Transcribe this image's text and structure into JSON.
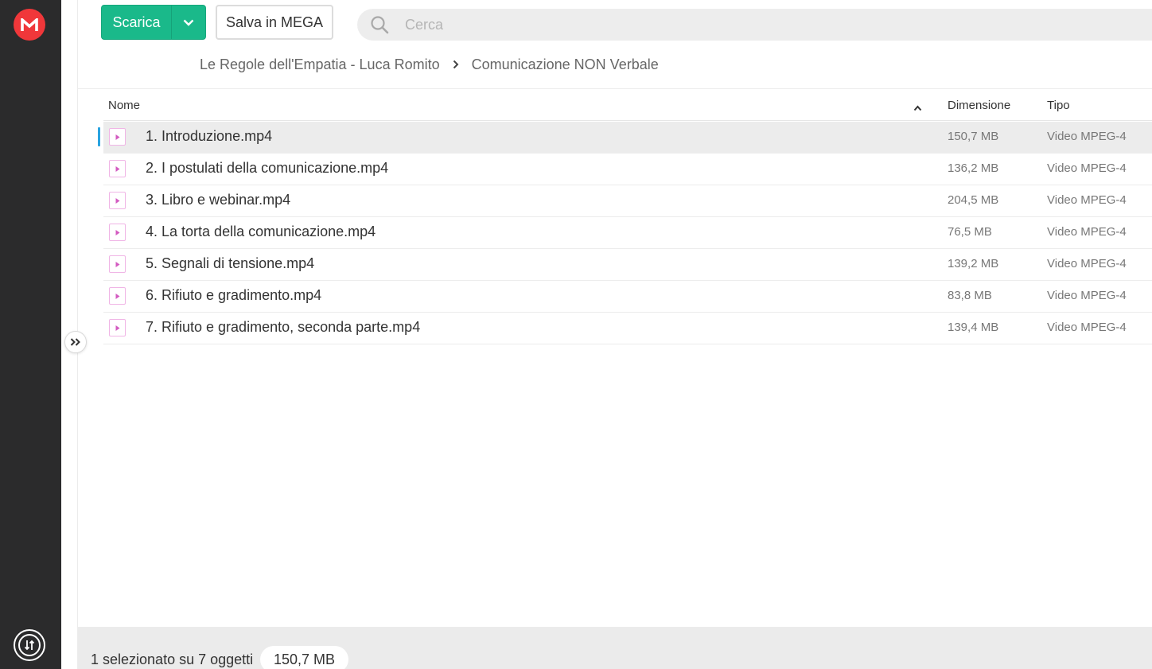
{
  "colors": {
    "rail": "#2b2b2c",
    "brand": "#f0373a",
    "download": "#1ab98a",
    "selection_marker": "#29a3e0",
    "file_icon": "#d35bc1"
  },
  "toolbar": {
    "download_label": "Scarica",
    "save_label": "Salva in MEGA"
  },
  "search": {
    "placeholder": "Cerca"
  },
  "breadcrumb": [
    {
      "label": "Le Regole dell'Empatia - Luca Romito"
    },
    {
      "label": "Comunicazione NON Verbale"
    }
  ],
  "table": {
    "columns": {
      "name": "Nome",
      "size": "Dimensione",
      "type": "Tipo"
    },
    "rows": [
      {
        "name": "1. Introduzione.mp4",
        "size": "150,7 MB",
        "type": "Video MPEG-4",
        "selected": true
      },
      {
        "name": "2. I postulati della comunicazione.mp4",
        "size": "136,2 MB",
        "type": "Video MPEG-4",
        "selected": false
      },
      {
        "name": "3. Libro e webinar.mp4",
        "size": "204,5 MB",
        "type": "Video MPEG-4",
        "selected": false
      },
      {
        "name": "4. La torta della comunicazione.mp4",
        "size": "76,5 MB",
        "type": "Video MPEG-4",
        "selected": false
      },
      {
        "name": "5. Segnali di tensione.mp4",
        "size": "139,2 MB",
        "type": "Video MPEG-4",
        "selected": false
      },
      {
        "name": "6. Rifiuto e gradimento.mp4",
        "size": "83,8 MB",
        "type": "Video MPEG-4",
        "selected": false
      },
      {
        "name": "7. Rifiuto e gradimento, seconda parte.mp4",
        "size": "139,4 MB",
        "type": "Video MPEG-4",
        "selected": false
      }
    ]
  },
  "footer": {
    "status": "1 selezionato su 7 oggetti",
    "selected_size": "150,7 MB"
  }
}
